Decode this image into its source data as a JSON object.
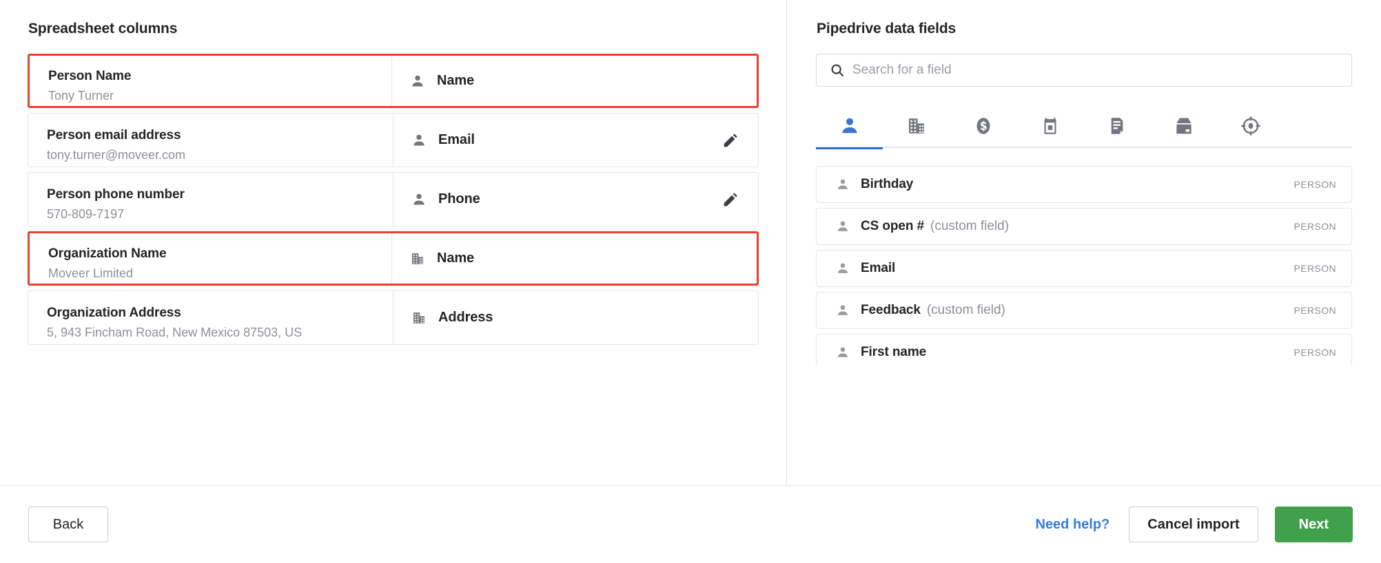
{
  "left": {
    "title": "Spreadsheet columns",
    "rows": [
      {
        "column_name": "Person Name",
        "sample_value": "Tony Turner",
        "mapped_field": "Name",
        "mapped_icon": "person-icon",
        "highlighted": true,
        "editable": false
      },
      {
        "column_name": "Person email address",
        "sample_value": "tony.turner@moveer.com",
        "mapped_field": "Email",
        "mapped_icon": "person-icon",
        "highlighted": false,
        "editable": true
      },
      {
        "column_name": "Person phone number",
        "sample_value": "570-809-7197",
        "mapped_field": "Phone",
        "mapped_icon": "person-icon",
        "highlighted": false,
        "editable": true
      },
      {
        "column_name": "Organization Name",
        "sample_value": "Moveer Limited",
        "mapped_field": "Name",
        "mapped_icon": "organization-icon",
        "highlighted": true,
        "editable": false
      },
      {
        "column_name": "Organization Address",
        "sample_value": "5, 943 Fincham Road, New Mexico 87503, US",
        "mapped_field": "Address",
        "mapped_icon": "organization-icon",
        "highlighted": false,
        "editable": false
      }
    ]
  },
  "right": {
    "title": "Pipedrive data fields",
    "search": {
      "value": "",
      "placeholder": "Search for a field",
      "icon": "search-icon"
    },
    "tabs": [
      {
        "icon": "person-icon",
        "name": "person",
        "active": true
      },
      {
        "icon": "organization-icon",
        "name": "organization",
        "active": false
      },
      {
        "icon": "deal-icon",
        "name": "deal",
        "active": false
      },
      {
        "icon": "activity-icon",
        "name": "activity",
        "active": false
      },
      {
        "icon": "note-icon",
        "name": "note",
        "active": false
      },
      {
        "icon": "product-icon",
        "name": "product",
        "active": false
      },
      {
        "icon": "lead-icon",
        "name": "lead",
        "active": false
      }
    ],
    "fields": [
      {
        "name": "Birthday",
        "suffix": "",
        "type": "PERSON",
        "icon": "person-icon"
      },
      {
        "name": "CS open #",
        "suffix": "(custom field)",
        "type": "PERSON",
        "icon": "person-icon"
      },
      {
        "name": "Email",
        "suffix": "",
        "type": "PERSON",
        "icon": "person-icon"
      },
      {
        "name": "Feedback",
        "suffix": "(custom field)",
        "type": "PERSON",
        "icon": "person-icon"
      },
      {
        "name": "First name",
        "suffix": "",
        "type": "PERSON",
        "icon": "person-icon"
      }
    ]
  },
  "footer": {
    "back_label": "Back",
    "need_help_label": "Need help?",
    "cancel_label": "Cancel import",
    "next_label": "Next"
  },
  "colors": {
    "highlight_red": "#e8402a",
    "primary_green": "#41a04c",
    "link_blue": "#377bd8",
    "tab_active_blue": "#2e6bd2",
    "muted_gray": "#8d9096"
  }
}
